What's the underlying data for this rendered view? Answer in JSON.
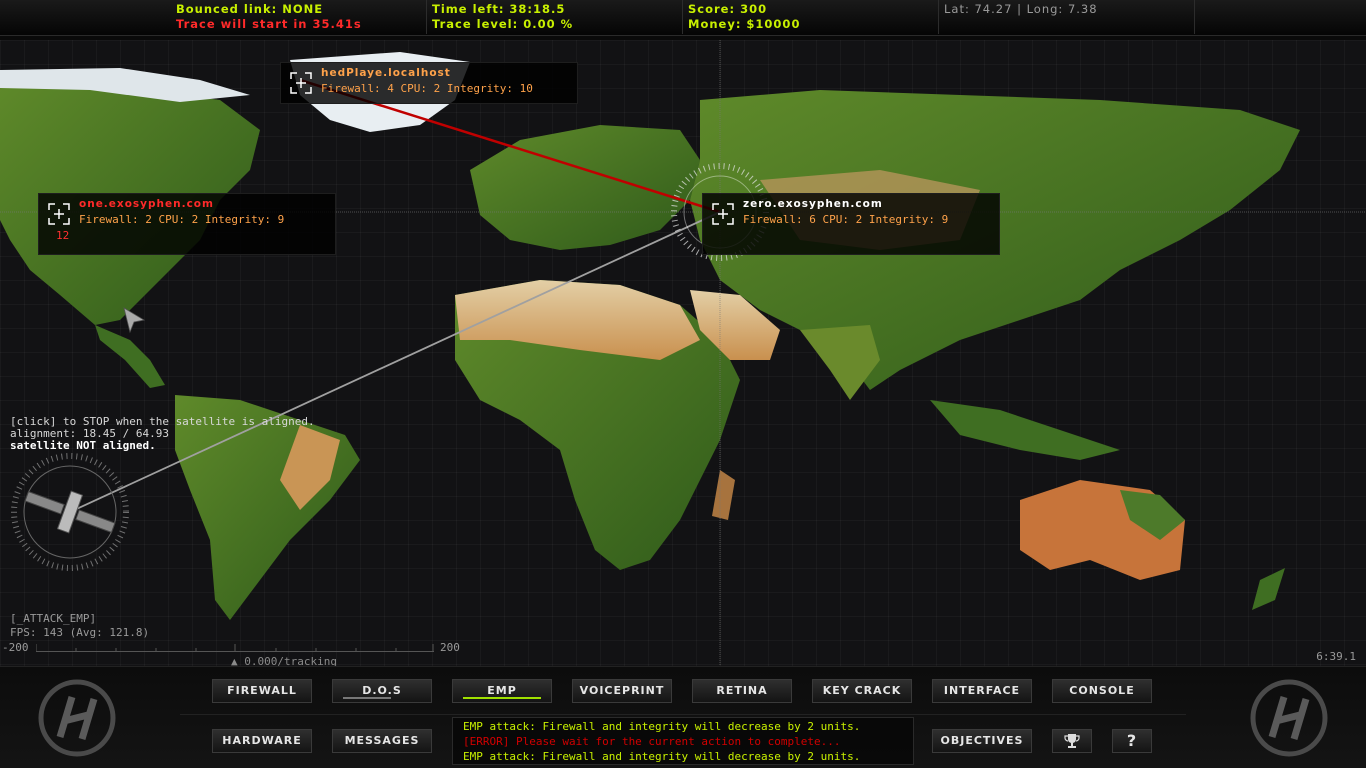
{
  "top": {
    "bounced_label": "Bounced link: NONE",
    "trace_start": "Trace will start in 35.41s",
    "time_left": "Time left: 38:18.5",
    "trace_level": "Trace level: 0.00 %",
    "score": "Score: 300",
    "money": "Money: $10000",
    "latlong": "Lat: 74.27 | Long: 7.38"
  },
  "nodes": {
    "local": {
      "name": "hedPlaye.localhost",
      "stats": "Firewall: 4 CPU: 2 Integrity: 10"
    },
    "one": {
      "name": "one.exosyphen.com",
      "stats": "Firewall: 2 CPU: 2 Integrity: 9",
      "extra": "12"
    },
    "zero": {
      "name": "zero.exosyphen.com",
      "stats": "Firewall: 6 CPU: 2 Integrity: 9"
    }
  },
  "hint": {
    "line1": "[click] to STOP when the satellite is aligned.",
    "line2": "alignment: 18.45 / 64.93",
    "line3": "satellite NOT aligned."
  },
  "status": {
    "attack": "[_ATTACK_EMP]",
    "fps": "FPS: 143 (Avg: 121.8)",
    "min": "-200",
    "max": "200",
    "tracking": "▲ 0.000/tracking",
    "clock": "6:39.1"
  },
  "buttons": {
    "firewall": "FIREWALL",
    "dos": "D.O.S",
    "emp": "EMP",
    "voiceprint": "VOICEPRINT",
    "retina": "RETINA",
    "keycrack": "KEY CRACK",
    "interface": "INTERFACE",
    "console": "CONSOLE",
    "hardware": "HARDWARE",
    "messages": "MESSAGES",
    "objectives": "OBJECTIVES",
    "help": "?"
  },
  "console_lines": [
    "EMP attack: Firewall and integrity will decrease by 2 units.",
    "[ERROR] Please wait for the current action to complete...",
    "EMP attack: Firewall and integrity will decrease by 2 units."
  ],
  "colors": {
    "accent": "#c8f000",
    "danger": "#ff2a2a",
    "node_orange": "#ffa24a"
  },
  "icons": {
    "logo": "hacker-h-logo-icon",
    "trophy": "trophy-icon",
    "crosshair": "crosshair-icon",
    "satellite": "satellite-icon"
  }
}
